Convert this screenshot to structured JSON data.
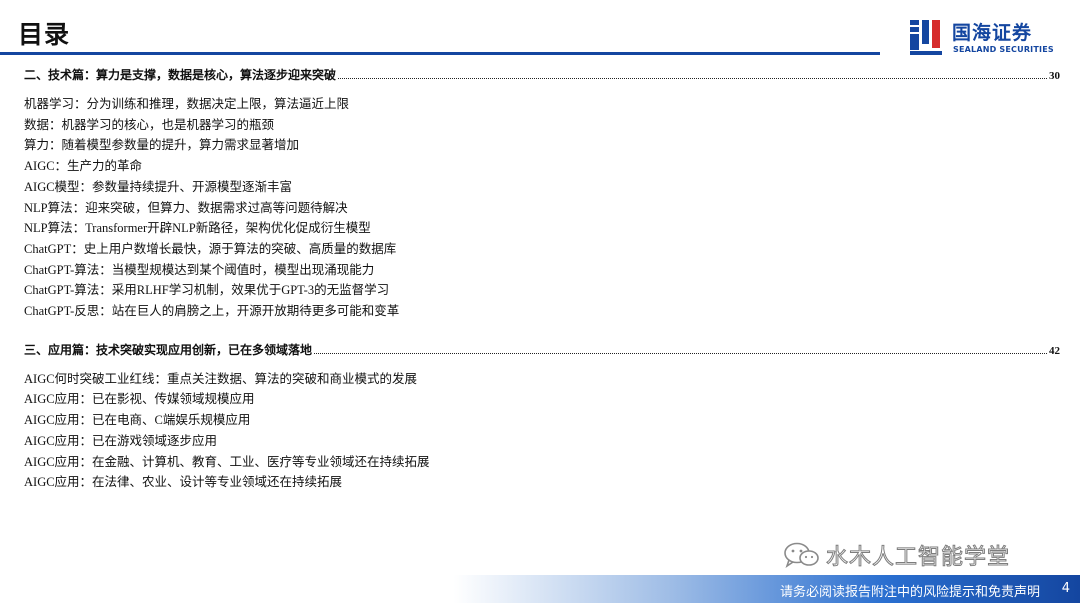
{
  "header": {
    "title": "目录",
    "logo_cn": "国海证券",
    "logo_en": "SEALAND SECURITIES"
  },
  "toc": {
    "sections": [
      {
        "title": "二、技术篇：算力是支撑，数据是核心，算法逐步迎来突破",
        "page": "30",
        "items": [
          "机器学习：分为训练和推理，数据决定上限，算法逼近上限",
          "数据：机器学习的核心，也是机器学习的瓶颈",
          "算力：随着模型参数量的提升，算力需求显著增加",
          "AIGC：生产力的革命",
          "AIGC模型：参数量持续提升、开源模型逐渐丰富",
          "NLP算法：迎来突破，但算力、数据需求过高等问题待解决",
          "NLP算法：Transformer开辟NLP新路径，架构优化促成衍生模型",
          "ChatGPT：史上用户数增长最快，源于算法的突破、高质量的数据库",
          "ChatGPT-算法：当模型规模达到某个阈值时，模型出现涌现能力",
          "ChatGPT-算法：采用RLHF学习机制，效果优于GPT-3的无监督学习",
          "ChatGPT-反思：站在巨人的肩膀之上，开源开放期待更多可能和变革"
        ]
      },
      {
        "title": "三、应用篇：技术突破实现应用创新，已在多领域落地",
        "page": "42",
        "items": [
          "AIGC何时突破工业红线：重点关注数据、算法的突破和商业模式的发展",
          "AIGC应用：已在影视、传媒领域规模应用",
          "AIGC应用：已在电商、C端娱乐规模应用",
          "AIGC应用：已在游戏领域逐步应用",
          "AIGC应用：在金融、计算机、教育、工业、医疗等专业领域还在持续拓展",
          "AIGC应用：在法律、农业、设计等专业领域还在持续拓展"
        ]
      }
    ]
  },
  "watermark": {
    "text": "水木人工智能学堂",
    "icon": "wechat-icon"
  },
  "footer": {
    "disclaimer": "请务必阅读报告附注中的风险提示和免责声明",
    "page_number": "4"
  },
  "colors": {
    "brand_blue": "#1446a0",
    "footer_gradient_end": "#1446a0"
  }
}
